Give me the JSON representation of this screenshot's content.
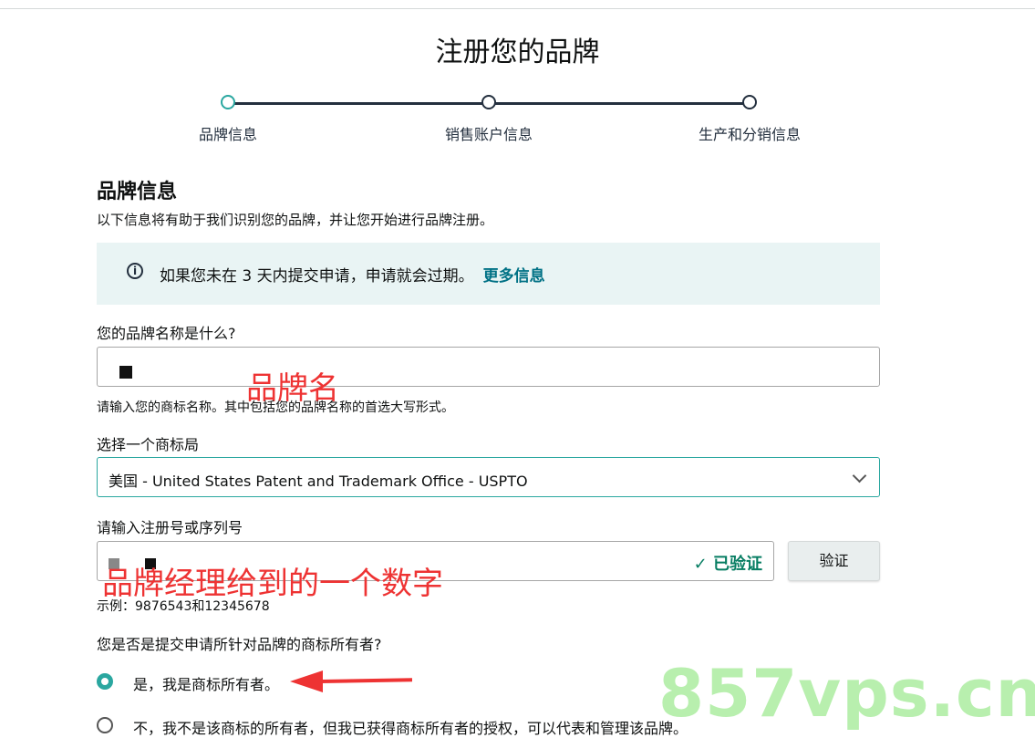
{
  "page": {
    "title": "注册您的品牌"
  },
  "steps": [
    {
      "label": "品牌信息",
      "state": "active"
    },
    {
      "label": "销售账户信息",
      "state": "pending"
    },
    {
      "label": "生产和分销信息",
      "state": "pending"
    }
  ],
  "section": {
    "title": "品牌信息",
    "subtitle": "以下信息将有助于我们识别您的品牌，并让您开始进行品牌注册。"
  },
  "info": {
    "icon": "info-icon",
    "text": "如果您未在 3 天内提交申请，申请就会过期。",
    "link": "更多信息"
  },
  "brand_name": {
    "label": "您的品牌名称是什么?",
    "annotation": "品牌名",
    "hint": "请输入您的商标名称。其中包括您的品牌名称的首选大写形式。"
  },
  "trademark_office": {
    "label": "选择一个商标局",
    "selected": "美国 - United States Patent and Trademark Office - USPTO"
  },
  "serial": {
    "label": "请输入注册号或序列号",
    "annotation": "品牌经理给到的一个数字",
    "verified_text": "已验证",
    "verify_button": "验证",
    "example": "示例：9876543和12345678"
  },
  "owner_question": {
    "label": "您是否是提交申请所针对品牌的商标所有者?",
    "options": [
      {
        "label": "是，我是商标所有者。",
        "checked": true
      },
      {
        "label": "不，我不是该商标的所有者，但我已获得商标所有者的授权，可以代表和管理该品牌。",
        "checked": false
      }
    ]
  },
  "watermark": "857vps.cn",
  "colors": {
    "accent": "#2aa7a0",
    "link": "#007185",
    "verified": "#067d62",
    "annotation": "#e33333",
    "info_bg": "#e9f4f4"
  }
}
